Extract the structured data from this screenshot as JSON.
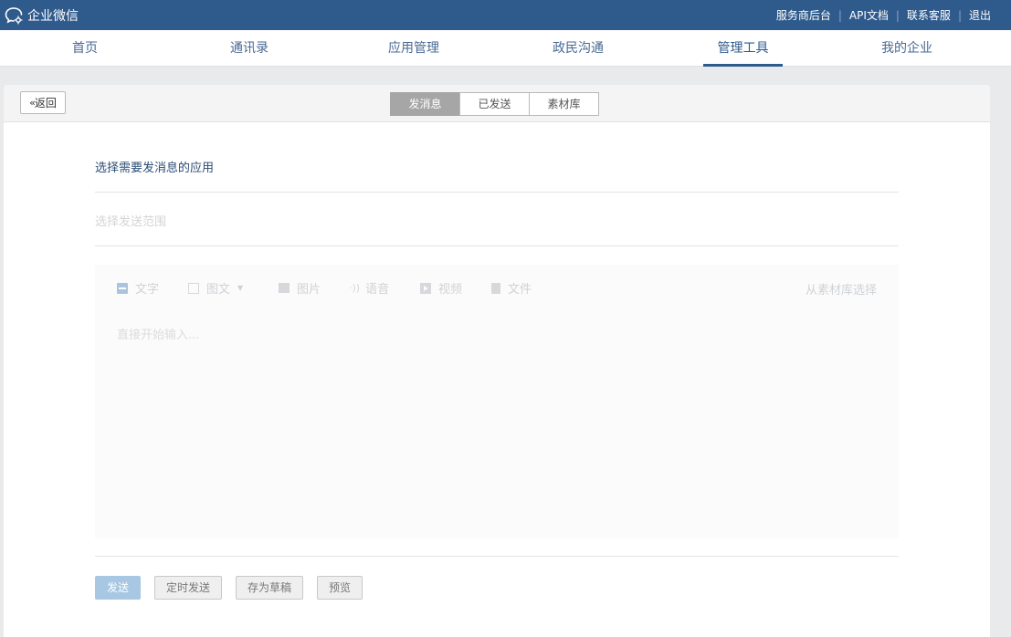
{
  "app": {
    "title": "企业微信",
    "icon": "wechat-work-logo-icon"
  },
  "toplinks": {
    "service_admin": "服务商后台",
    "api_docs": "API文档",
    "support": "联系客服",
    "logout": "退出",
    "separator": "|"
  },
  "nav": {
    "items": [
      {
        "label": "首页"
      },
      {
        "label": "通讯录"
      },
      {
        "label": "应用管理"
      },
      {
        "label": "政民沟通"
      },
      {
        "label": "管理工具"
      },
      {
        "label": "我的企业"
      }
    ],
    "active_index": 4
  },
  "panel": {
    "back_label": "返回",
    "back_icon": "double-chevron-left-icon",
    "tabs": [
      {
        "label": "发消息"
      },
      {
        "label": "已发送"
      },
      {
        "label": "素材库"
      }
    ],
    "active_tab": 0
  },
  "form": {
    "select_app": "选择需要发消息的应用",
    "select_range": "选择发送范围"
  },
  "editor": {
    "tools": [
      {
        "label": "文字",
        "icon": "text-icon"
      },
      {
        "label": "图文",
        "icon": "news-icon",
        "caret": "▼"
      },
      {
        "label": "图片",
        "icon": "image-icon"
      },
      {
        "label": "语音",
        "icon": "voice-icon"
      },
      {
        "label": "视频",
        "icon": "video-icon"
      },
      {
        "label": "文件",
        "icon": "file-icon"
      }
    ],
    "from_library": "从素材库选择",
    "placeholder": "直接开始输入..."
  },
  "actions": {
    "send": "发送",
    "schedule": "定时发送",
    "draft": "存为草稿",
    "preview": "预览"
  },
  "colors": {
    "topbar": "#2f5a8c",
    "send_button": "#a7c7e3"
  }
}
